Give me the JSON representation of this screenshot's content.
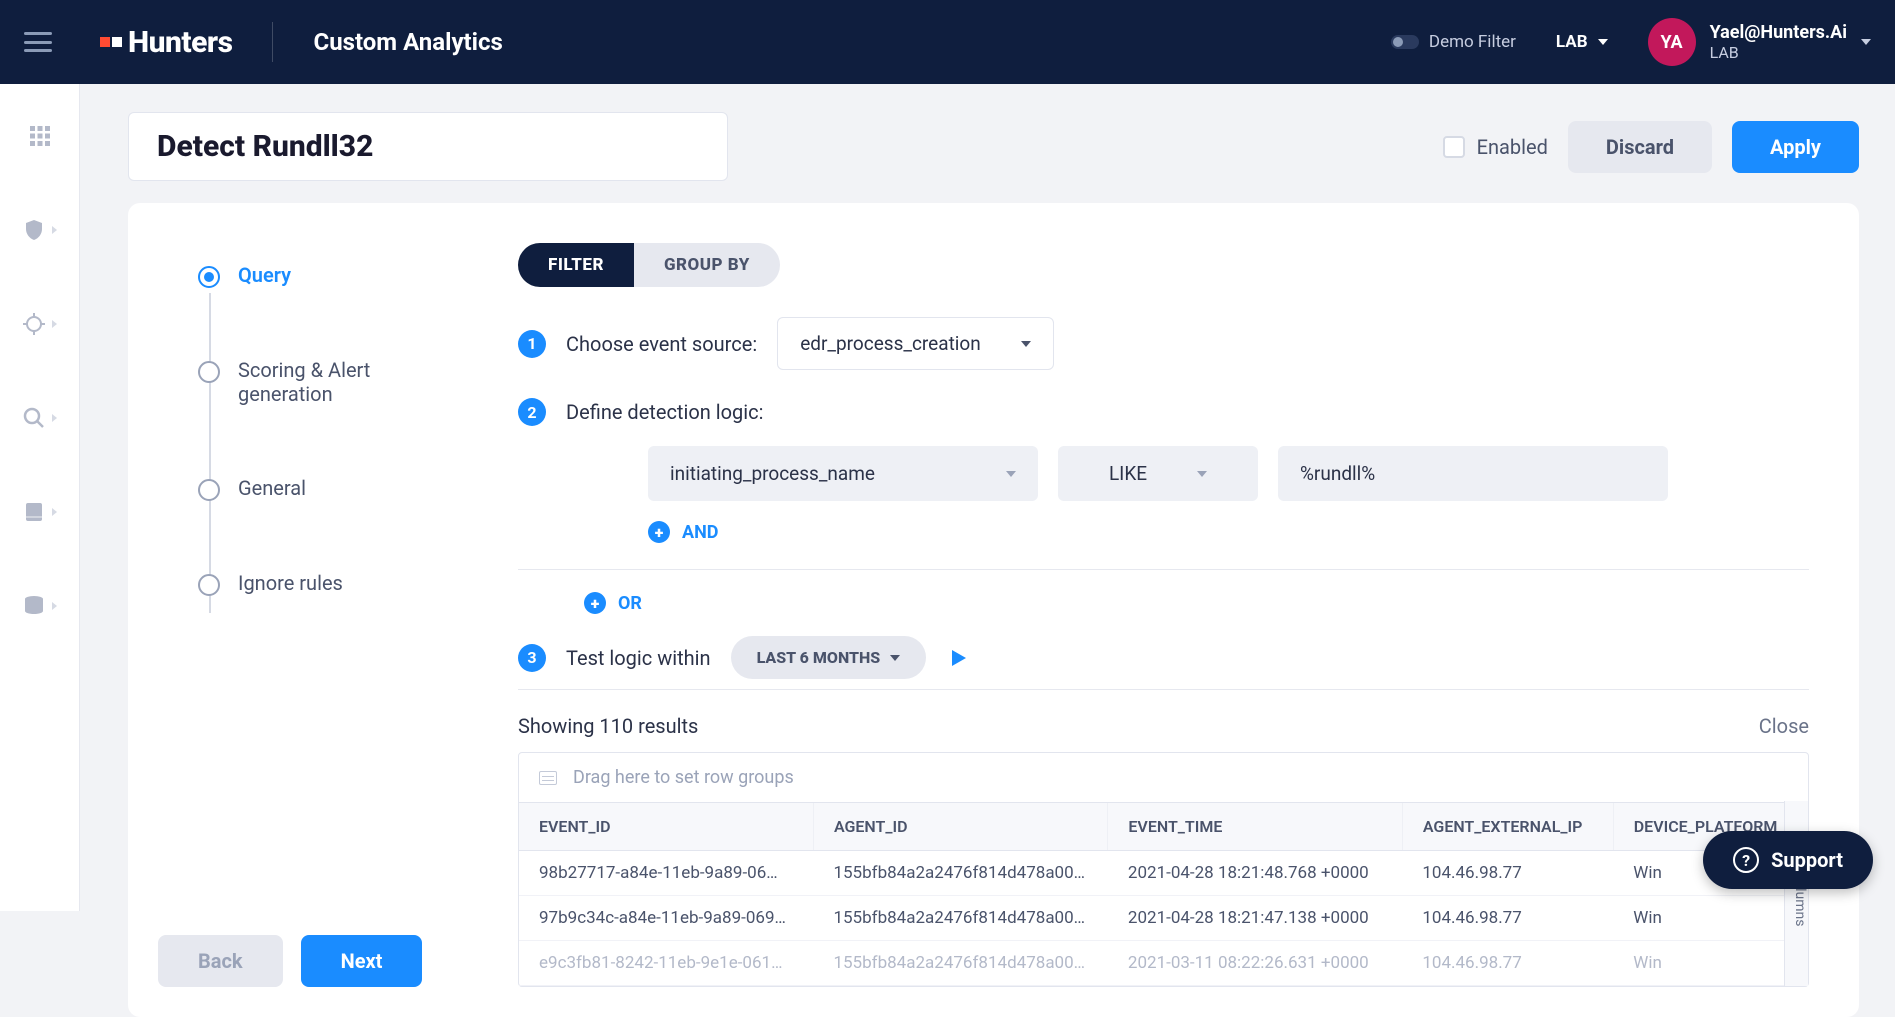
{
  "header": {
    "logo_text": "Hunters",
    "page_title": "Custom Analytics",
    "demo_filter_label": "Demo Filter",
    "env": "LAB",
    "avatar_initials": "YA",
    "user_name": "Yael@Hunters.Ai",
    "user_env": "LAB"
  },
  "main_header": {
    "title": "Detect Rundll32",
    "enabled_label": "Enabled",
    "discard_label": "Discard",
    "apply_label": "Apply"
  },
  "stepper": {
    "steps": [
      {
        "label": "Query",
        "active": true
      },
      {
        "label": "Scoring & Alert generation",
        "active": false
      },
      {
        "label": "General",
        "active": false
      },
      {
        "label": "Ignore rules",
        "active": false
      }
    ],
    "back_label": "Back",
    "next_label": "Next"
  },
  "segmented": {
    "filter_label": "FILTER",
    "groupby_label": "GROUP BY"
  },
  "section1": {
    "num": "1",
    "label": "Choose event source:",
    "value": "edr_process_creation"
  },
  "section2": {
    "num": "2",
    "label": "Define detection logic:",
    "field": "initiating_process_name",
    "operator": "LIKE",
    "value": "%rundll%",
    "and_label": "AND",
    "or_label": "OR"
  },
  "section3": {
    "num": "3",
    "label": "Test logic within",
    "range": "LAST 6 MONTHS"
  },
  "results": {
    "count_text": "Showing 110 results",
    "close_label": "Close",
    "drag_hint": "Drag here to set row groups",
    "columns_tab": "Columns",
    "headers": [
      "EVENT_ID",
      "AGENT_ID",
      "EVENT_TIME",
      "AGENT_EXTERNAL_IP",
      "DEVICE_PLATFORM"
    ],
    "rows": [
      {
        "c0": "98b27717-a84e-11eb-9a89-06…",
        "c1": "155bfb84a2a2476f814d478a00…",
        "c2": "2021-04-28 18:21:48.768 +0000",
        "c3": "104.46.98.77",
        "c4": "Win"
      },
      {
        "c0": "97b9c34c-a84e-11eb-9a89-069…",
        "c1": "155bfb84a2a2476f814d478a00…",
        "c2": "2021-04-28 18:21:47.138 +0000",
        "c3": "104.46.98.77",
        "c4": "Win"
      },
      {
        "c0": "e9c3fb81-8242-11eb-9e1e-061…",
        "c1": "155bfb84a2a2476f814d478a00…",
        "c2": "2021-03-11 08:22:26.631 +0000",
        "c3": "104.46.98.77",
        "c4": "Win"
      }
    ]
  },
  "support_label": "Support"
}
